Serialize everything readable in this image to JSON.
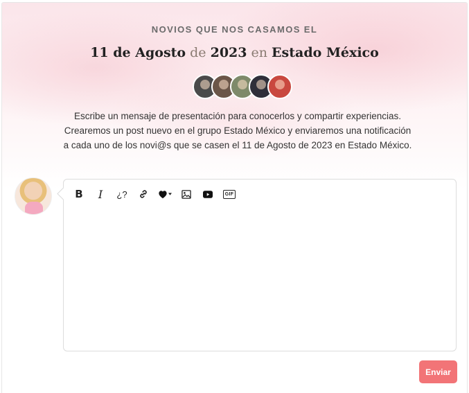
{
  "header": {
    "eyebrow": "NOVIOS QUE NOS CASAMOS EL",
    "headline_parts": [
      "11 de Agosto",
      " de ",
      "2023",
      " en ",
      "Estado México"
    ]
  },
  "avatars": [
    {
      "color": "#4a4a4a"
    },
    {
      "color": "#6b5648"
    },
    {
      "color": "#7e8a6a"
    },
    {
      "color": "#2f2f3a"
    },
    {
      "color": "#c9483f"
    }
  ],
  "intro": {
    "line1": "Escribe un mensaje de presentación para conocerlos y compartir experiencias.",
    "line2": "Crearemos un post nuevo en el grupo Estado México y enviaremos una notificación",
    "line3": "a cada uno de los novi@s que se casen el 11 de Agosto de 2023 en Estado México."
  },
  "toolbar": {
    "bold_label": "B",
    "italic_label": "I",
    "question_label": "¿?",
    "gif_label": "GIF"
  },
  "editor": {
    "value": "",
    "placeholder": ""
  },
  "actions": {
    "send_label": "Enviar"
  },
  "colors": {
    "accent": "#f27477",
    "wash": "#fbe5ea"
  }
}
